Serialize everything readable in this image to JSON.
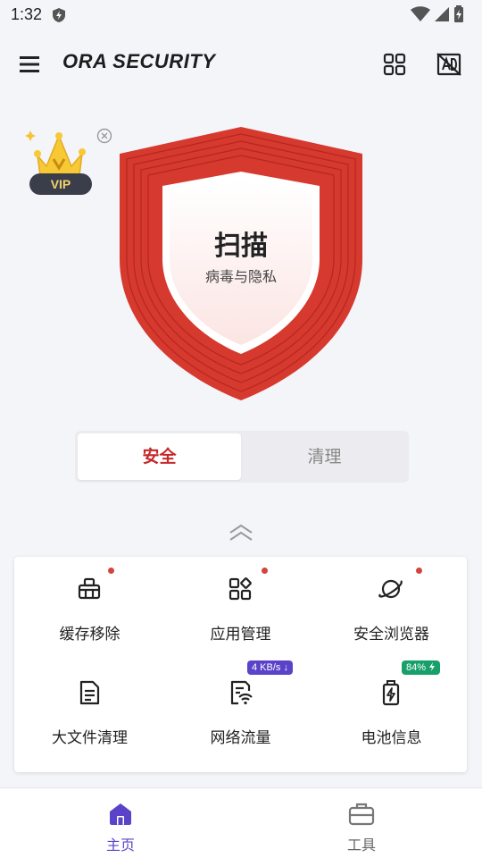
{
  "status_bar": {
    "time": "1:32"
  },
  "app_bar": {
    "title": "ORA SECURITY"
  },
  "vip": {
    "label": "VIP"
  },
  "scan": {
    "title": "扫描",
    "subtitle": "病毒与隐私"
  },
  "mode_tabs": [
    {
      "label": "安全",
      "active": true
    },
    {
      "label": "清理",
      "active": false
    }
  ],
  "features": [
    {
      "label": "缓存移除",
      "icon": "broom-icon",
      "has_dot": true
    },
    {
      "label": "应用管理",
      "icon": "apps-icon",
      "has_dot": true
    },
    {
      "label": "安全浏览器",
      "icon": "planet-icon",
      "has_dot": true
    },
    {
      "label": "大文件清理",
      "icon": "file-icon",
      "has_dot": false
    },
    {
      "label": "网络流量",
      "icon": "network-icon",
      "badge": "4 KB/s ↓"
    },
    {
      "label": "电池信息",
      "icon": "battery-icon",
      "badge": "84%"
    }
  ],
  "bottom_nav": [
    {
      "label": "主页",
      "icon": "home-icon",
      "active": true
    },
    {
      "label": "工具",
      "icon": "toolbox-icon",
      "active": false
    }
  ],
  "colors": {
    "accent": "#5a43c9",
    "danger": "#c5282a",
    "shield": "#d6392e"
  }
}
